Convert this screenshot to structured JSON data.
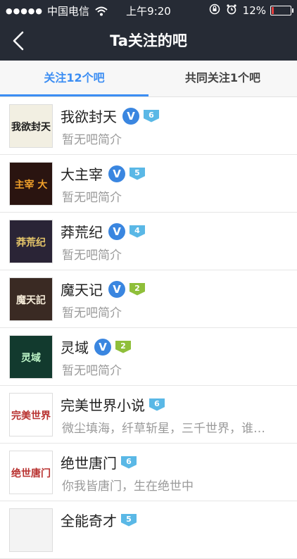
{
  "status_bar": {
    "signal": "●●●●●",
    "carrier": "中国电信",
    "time": "上午9:20",
    "battery_text": "12%",
    "battery_level": 0.12
  },
  "navbar": {
    "title": "Ta关注的吧"
  },
  "tabs": [
    {
      "label": "关注12个吧",
      "active": true
    },
    {
      "label": "共同关注1个吧",
      "active": false
    }
  ],
  "bars": [
    {
      "name": "我欲封天",
      "verified": true,
      "level": "6",
      "level_color": "#5ab8e6",
      "desc": "暂无吧简介",
      "avatar_text": "我欲封天",
      "avatar_bg": "#f2efe2",
      "avatar_fg": "#1b1b1b"
    },
    {
      "name": "大主宰",
      "verified": true,
      "level": "5",
      "level_color": "#5ab8e6",
      "desc": "暂无吧简介",
      "avatar_text": "主宰 大",
      "avatar_bg": "#2a1410",
      "avatar_fg": "#f2a12a"
    },
    {
      "name": "莽荒纪",
      "verified": true,
      "level": "4",
      "level_color": "#5ab8e6",
      "desc": "暂无吧简介",
      "avatar_text": "莽荒纪",
      "avatar_bg": "#2a2436",
      "avatar_fg": "#e6c66a"
    },
    {
      "name": "魔天记",
      "verified": true,
      "level": "2",
      "level_color": "#8fbf3a",
      "desc": "暂无吧简介",
      "avatar_text": "魔天記",
      "avatar_bg": "#3a2a23",
      "avatar_fg": "#f4ead7"
    },
    {
      "name": "灵域",
      "verified": true,
      "level": "2",
      "level_color": "#8fbf3a",
      "desc": "暂无吧简介",
      "avatar_text": "灵域",
      "avatar_bg": "#123a2e",
      "avatar_fg": "#bff6c8"
    },
    {
      "name": "完美世界小说",
      "verified": false,
      "level": "6",
      "level_color": "#5ab8e6",
      "desc": "微尘填海，纤草斩星，三千世界，谁…",
      "avatar_text": "完美世界",
      "avatar_bg": "#ffffff",
      "avatar_fg": "#b8312f"
    },
    {
      "name": "绝世唐门",
      "verified": false,
      "level": "6",
      "level_color": "#5ab8e6",
      "desc": "你我皆唐门，生在绝世中",
      "avatar_text": "绝世唐门",
      "avatar_bg": "#ffffff",
      "avatar_fg": "#b8312f"
    },
    {
      "name": "全能奇才",
      "verified": false,
      "level": "5",
      "level_color": "#5ab8e6",
      "desc": "",
      "avatar_text": "",
      "avatar_bg": "#f3f3f3",
      "avatar_fg": "#666666"
    }
  ]
}
